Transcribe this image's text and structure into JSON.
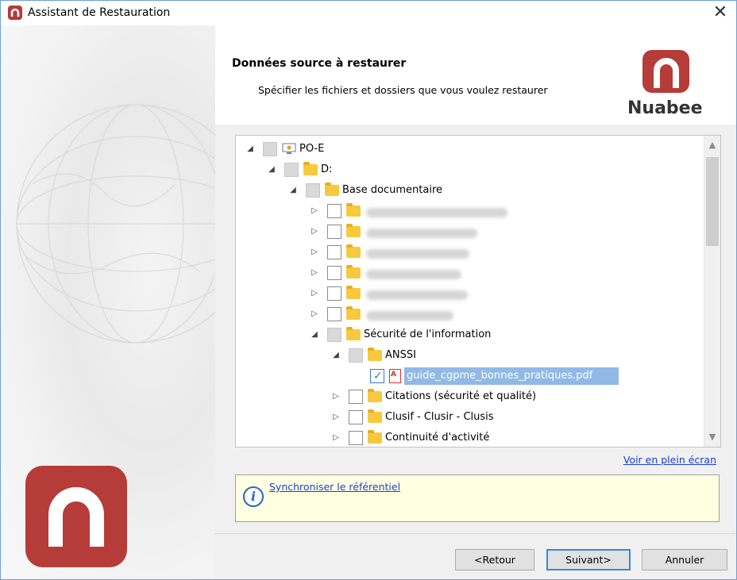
{
  "window": {
    "title": "Assistant de Restauration",
    "close_glyph": "✕"
  },
  "header": {
    "title": "Données source à restaurer",
    "subtitle": "Spécifier les fichiers et dossiers que vous voulez restaurer",
    "brand": "Nuabee"
  },
  "tree": {
    "nodes": [
      {
        "label": "PO-E",
        "icon": "computer-icon",
        "state": "partial",
        "expanded": true
      },
      {
        "label": "D:",
        "icon": "folder-icon",
        "state": "partial",
        "expanded": true
      },
      {
        "label": "Base documentaire",
        "icon": "folder-icon",
        "state": "partial",
        "expanded": true
      },
      {
        "label": "",
        "icon": "folder-icon",
        "state": "unchecked",
        "expanded": false,
        "blurred": true
      },
      {
        "label": "",
        "icon": "folder-icon",
        "state": "unchecked",
        "expanded": false,
        "blurred": true
      },
      {
        "label": "",
        "icon": "folder-icon",
        "state": "unchecked",
        "expanded": false,
        "blurred": true
      },
      {
        "label": "",
        "icon": "folder-icon",
        "state": "unchecked",
        "expanded": false,
        "blurred": true
      },
      {
        "label": "",
        "icon": "folder-icon",
        "state": "unchecked",
        "expanded": false,
        "blurred": true
      },
      {
        "label": "",
        "icon": "folder-icon",
        "state": "unchecked",
        "expanded": false,
        "blurred": true
      },
      {
        "label": "Sécurité de l'information",
        "icon": "folder-icon",
        "state": "partial",
        "expanded": true
      },
      {
        "label": "ANSSI",
        "icon": "folder-icon",
        "state": "partial",
        "expanded": true
      },
      {
        "label": "guide_cgpme_bonnes_pratiques.pdf",
        "icon": "pdf-icon",
        "state": "checked",
        "selected": true
      },
      {
        "label": "Citations (sécurité et qualité)",
        "icon": "folder-icon",
        "state": "unchecked",
        "expanded": false
      },
      {
        "label": "Clusif - Clusir - Clusis",
        "icon": "folder-icon",
        "state": "unchecked",
        "expanded": false
      },
      {
        "label": "Continuité d'activité",
        "icon": "folder-icon",
        "state": "unchecked",
        "expanded": false
      }
    ]
  },
  "links": {
    "fullscreen": "Voir en plein écran",
    "sync": "Synchroniser le référentiel"
  },
  "buttons": {
    "back": "<Retour",
    "next": "Suivant>",
    "cancel": "Annuler"
  },
  "colors": {
    "brand": "#b63c39",
    "selection": "#91b9e6",
    "link": "#1a3fd6",
    "info_bg": "#ffffe1"
  }
}
